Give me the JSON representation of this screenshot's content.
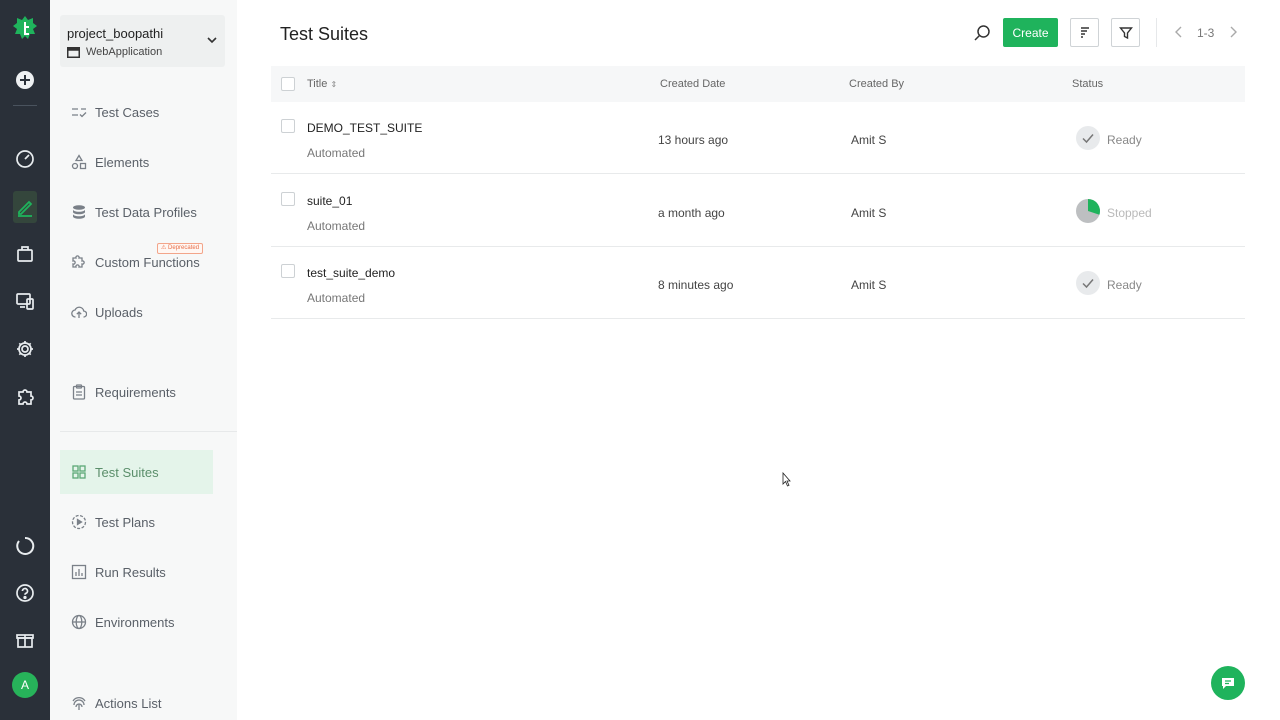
{
  "project": {
    "name": "project_boopathi",
    "type": "WebApplication"
  },
  "sidebar": {
    "items": [
      {
        "label": "Test Cases"
      },
      {
        "label": "Elements"
      },
      {
        "label": "Test Data Profiles"
      },
      {
        "label": "Custom Functions",
        "badge": "Deprecated"
      },
      {
        "label": "Uploads"
      },
      {
        "label": "Requirements"
      },
      {
        "label": "Test Suites",
        "active": true
      },
      {
        "label": "Test Plans"
      },
      {
        "label": "Run Results"
      },
      {
        "label": "Environments"
      },
      {
        "label": "Actions List"
      }
    ]
  },
  "user": {
    "initial": "A"
  },
  "header": {
    "title": "Test Suites",
    "create_label": "Create",
    "pagination": "1-3"
  },
  "table": {
    "columns": {
      "title": "Title",
      "created_date": "Created Date",
      "created_by": "Created By",
      "status": "Status"
    },
    "rows": [
      {
        "title": "DEMO_TEST_SUITE",
        "type": "Automated",
        "created_date": "13 hours ago",
        "created_by": "Amit S",
        "status": "Ready"
      },
      {
        "title": "suite_01",
        "type": "Automated",
        "created_date": "a month ago",
        "created_by": "Amit S",
        "status": "Stopped"
      },
      {
        "title": "test_suite_demo",
        "type": "Automated",
        "created_date": "8 minutes ago",
        "created_by": "Amit S",
        "status": "Ready"
      }
    ]
  },
  "colors": {
    "accent": "#1fb35c",
    "rail": "#2a3039",
    "active_bg": "#e4f4ea",
    "deprecated": "#e86f4a"
  },
  "icons": {
    "rail": [
      "testsigma-logo-icon",
      "add-circle-icon",
      "dashboard-icon",
      "edit-icon",
      "briefcase-icon",
      "devices-icon",
      "settings-icon",
      "addons-icon",
      "loader-icon",
      "help-icon",
      "gift-icon"
    ],
    "toolbar": [
      "search-icon",
      "sort-icon",
      "filter-icon",
      "chevron-left-icon",
      "chevron-right-icon"
    ],
    "status": [
      "ready-check-icon",
      "stopped-pie-icon"
    ],
    "support": "chat-icon"
  }
}
